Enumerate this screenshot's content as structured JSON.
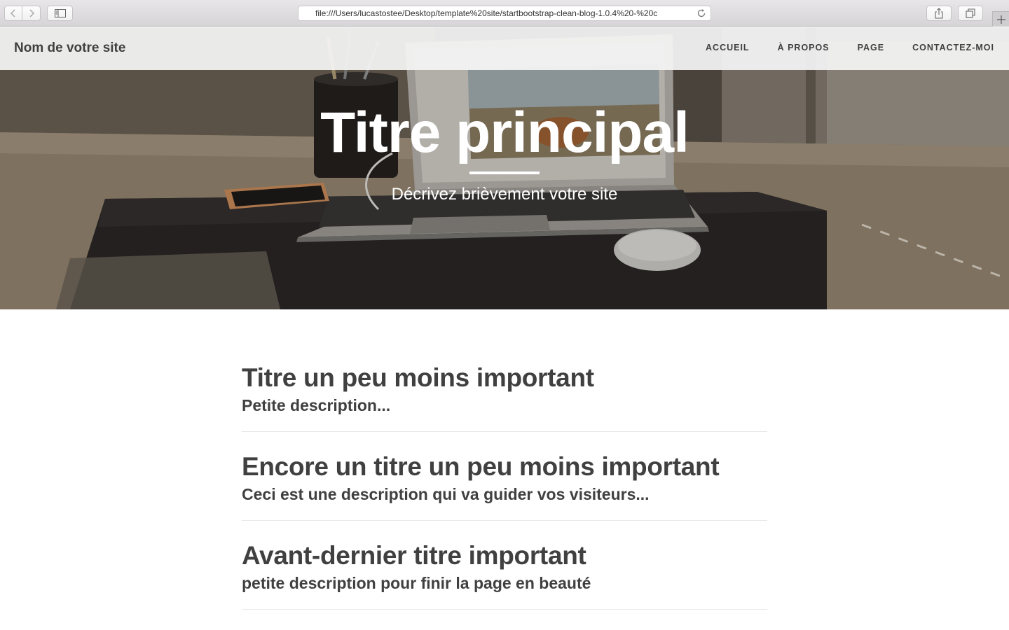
{
  "browser": {
    "url": "file:///Users/lucastostee/Desktop/template%20site/startbootstrap-clean-blog-1.0.4%20-%20c"
  },
  "navbar": {
    "brand": "Nom de votre site",
    "links": [
      {
        "label": "ACCUEIL"
      },
      {
        "label": "À PROPOS"
      },
      {
        "label": "PAGE"
      },
      {
        "label": "CONTACTEZ-MOI"
      }
    ]
  },
  "hero": {
    "title": "Titre principal",
    "subtitle": "Décrivez brièvement votre site"
  },
  "posts": [
    {
      "title": "Titre un peu moins important",
      "subtitle": "Petite description..."
    },
    {
      "title": "Encore un titre un peu moins important",
      "subtitle": "Ceci est une description qui va guider vos visiteurs..."
    },
    {
      "title": "Avant-dernier titre important",
      "subtitle": "petite description pour finir la page en beauté"
    }
  ],
  "icons": [
    "back-icon",
    "forward-icon",
    "sidebar-icon",
    "reload-icon",
    "share-icon",
    "tabs-icon",
    "new-tab-icon"
  ]
}
